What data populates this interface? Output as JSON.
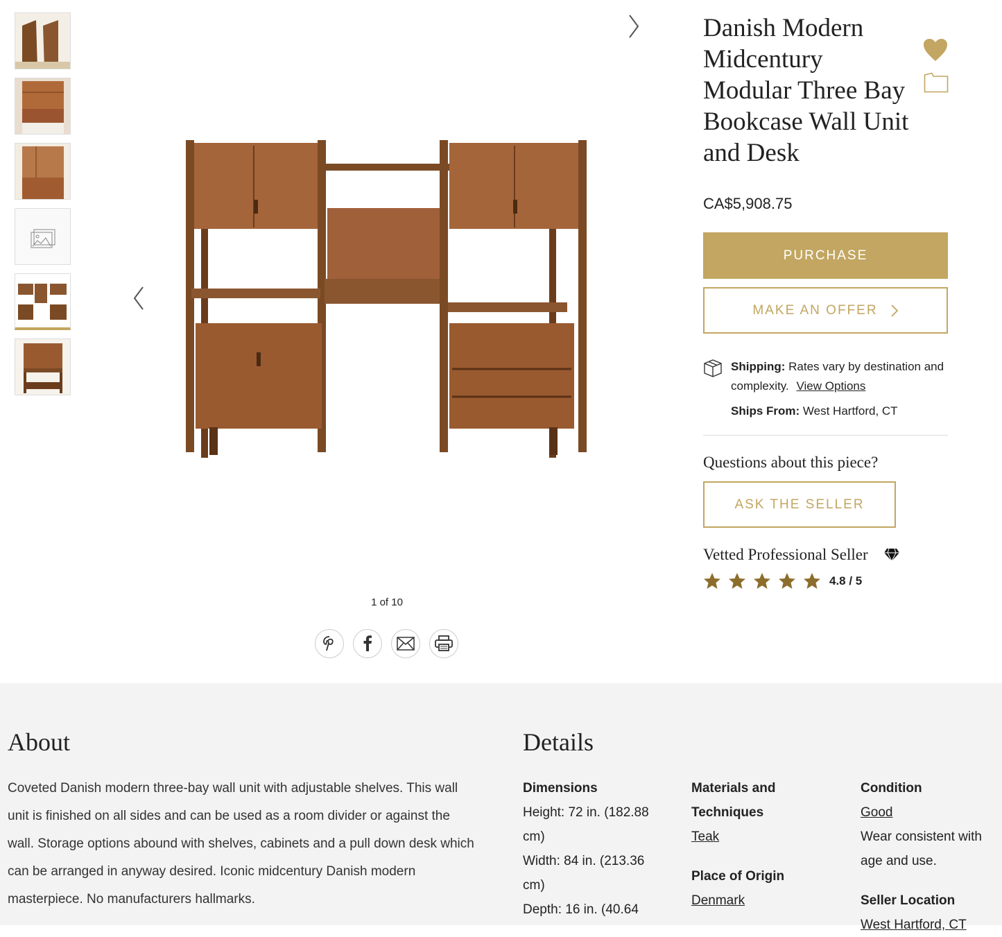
{
  "listing": {
    "title": "Danish Modern Midcentury Modular Three Bay Bookcase Wall Unit and Desk",
    "price": "CA$5,908.75",
    "purchase_label": "PURCHASE",
    "offer_label": "MAKE AN OFFER",
    "favorite_icon": "heart-icon",
    "folder_icon": "folder-icon"
  },
  "gallery": {
    "counter": "1 of 10",
    "thumbnail_count": 6,
    "active_thumbnail": 5
  },
  "shipping": {
    "label": "Shipping:",
    "text": "Rates vary by destination and complexity.",
    "link": "View Options",
    "from_label": "Ships From:",
    "from_value": "West Hartford, CT"
  },
  "seller": {
    "questions": "Questions about this piece?",
    "ask_label": "ASK THE SELLER",
    "vetted": "Vetted Professional Seller",
    "rating": "4.8 / 5",
    "stars": 4.8
  },
  "share": [
    "pinterest-icon",
    "facebook-icon",
    "email-icon",
    "print-icon"
  ],
  "about": {
    "heading": "About",
    "text": "Coveted Danish modern three-bay wall unit with adjustable shelves. This wall unit is finished on all sides and can be used as a room divider or against the wall. Storage options abound with shelves, cabinets and a pull down desk which can be arranged in anyway desired. Iconic midcentury Danish modern masterpiece. No manufacturers hallmarks."
  },
  "details": {
    "heading": "Details",
    "dimensions_label": "Dimensions",
    "dim_height": "Height: 72 in. (182.88 cm)",
    "dim_width": "Width: 84 in. (213.36 cm)",
    "dim_depth": "Depth: 16 in. (40.64",
    "materials_label": "Materials and Techniques",
    "materials_value": "Teak",
    "origin_label": "Place of Origin",
    "origin_value": "Denmark",
    "condition_label": "Condition",
    "condition_value": "Good",
    "condition_note": "Wear consistent with age and use.",
    "location_label": "Seller Location",
    "location_value": "West Hartford, CT"
  },
  "colors": {
    "accent": "#c2a661",
    "star": "#8c6d2c",
    "footer_bg": "#f3f3f3"
  }
}
